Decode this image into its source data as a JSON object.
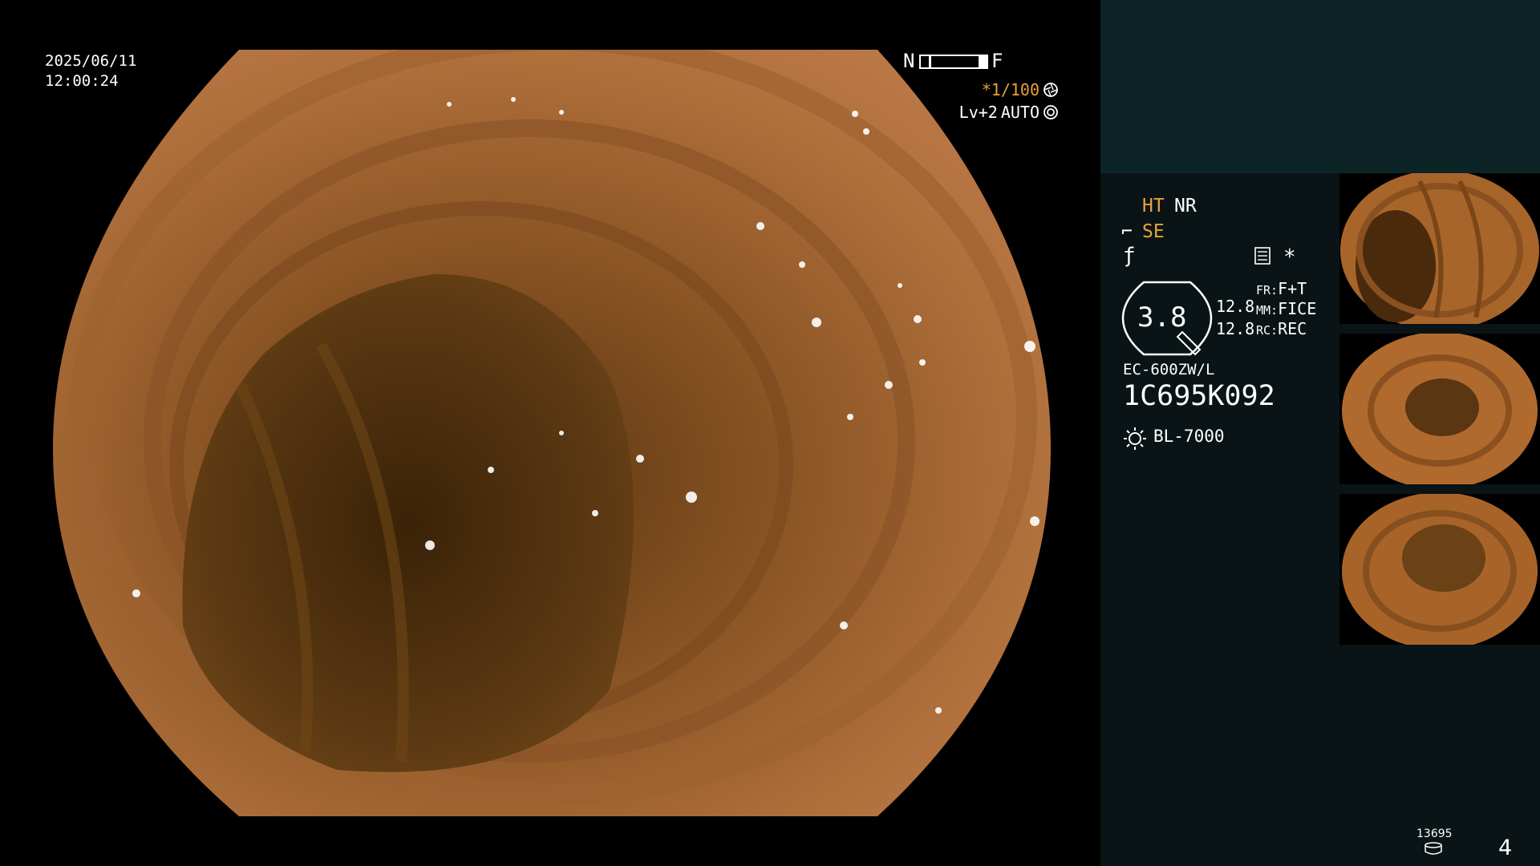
{
  "overlay": {
    "date": "2025/06/11",
    "time": "12:00:24",
    "nf_near": "N",
    "nf_far": "F",
    "shutter": "*1/100",
    "level": "Lv+2",
    "mode": "AUTO"
  },
  "panel": {
    "ht": "HT",
    "nr": "NR",
    "se": "SE",
    "gauge_value": "3.8",
    "val1": "12.8",
    "val2": "12.8",
    "fr_label": "FR:",
    "fr_value": "F+T",
    "mm_label": "MM:",
    "mm_value": "FICE",
    "rc_label": "RC:",
    "rc_value": "REC",
    "scope_model": "EC-600ZW/L",
    "scope_serial": "1C695K092",
    "light_source": "BL-7000",
    "counter": "13695",
    "page": "4"
  },
  "colors": {
    "accent": "#e8a33a",
    "panel_bg": "#0a1416",
    "panel_top": "#0d2427"
  },
  "icons": [
    "shutter-icon",
    "auto-icon",
    "light-source-icon",
    "storage-icon",
    "sep-icon"
  ]
}
